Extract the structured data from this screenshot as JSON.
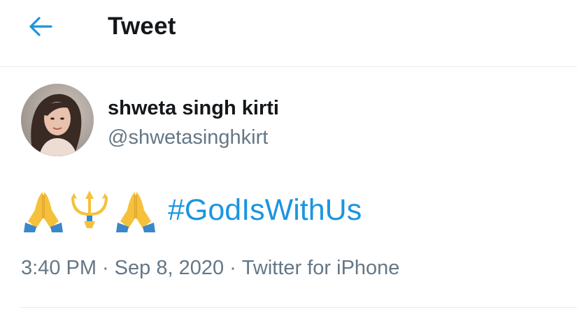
{
  "header": {
    "back_icon": "arrow-left-icon",
    "title": "Tweet"
  },
  "author": {
    "name": "shweta singh kirti",
    "handle": "@shwetasinghkirt"
  },
  "tweet": {
    "emojis": [
      "folded-hands-icon",
      "trident-icon",
      "folded-hands-icon"
    ],
    "hashtag": "#GodIsWithUs"
  },
  "meta": {
    "time": "3:40 PM",
    "separator": "·",
    "date": "Sep 8, 2020",
    "source": "Twitter for iPhone"
  },
  "colors": {
    "accent": "#1b95e0",
    "text_primary": "#14171a",
    "text_secondary": "#657786",
    "divider": "#e6ecf0"
  }
}
